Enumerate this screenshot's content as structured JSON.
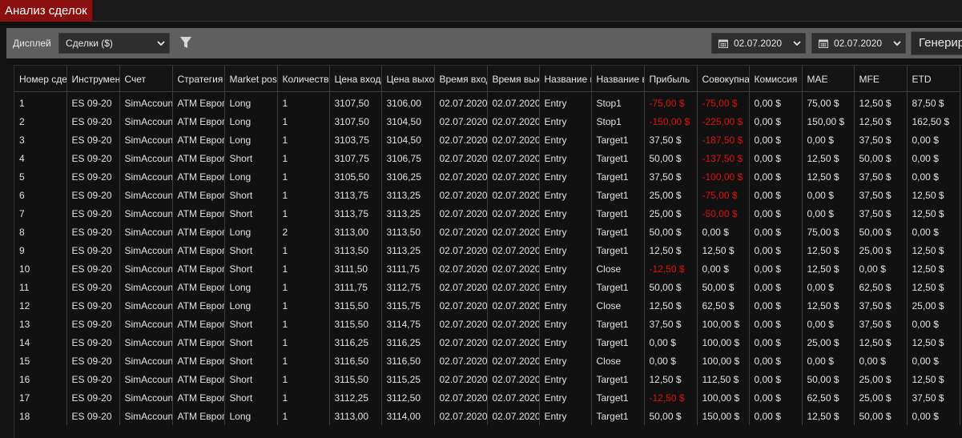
{
  "window": {
    "title": "Анализ сделок"
  },
  "toolbar": {
    "display_label": "Дисплей",
    "display_value": "Сделки ($)",
    "date_from": "02.07.2020",
    "date_to": "02.07.2020",
    "generate_label": "Генерировать"
  },
  "colors": {
    "negative": "#e01010",
    "title_accent": "#8b1111"
  },
  "table": {
    "columns": [
      "Номер сделки",
      "Инструмент",
      "Счет",
      "Стратегия",
      "Market position",
      "Количество",
      "Цена входа",
      "Цена выхода",
      "Время входа",
      "Время выхода",
      "Название входа",
      "Название выхода",
      "Прибыль",
      "Совокупная прибыль",
      "Комиссия",
      "MAE",
      "MFE",
      "ETD"
    ],
    "rows": [
      [
        "1",
        "ES 09-20",
        "SimAccount",
        "ATM Европа",
        "Long",
        "1",
        "3107,50",
        "3106,00",
        "02.07.2020",
        "02.07.2020",
        "Entry",
        "Stop1",
        "-75,00 $",
        "-75,00 $",
        "0,00 $",
        "75,00 $",
        "12,50 $",
        "87,50 $"
      ],
      [
        "2",
        "ES 09-20",
        "SimAccount",
        "ATM Европа",
        "Long",
        "1",
        "3107,50",
        "3104,50",
        "02.07.2020",
        "02.07.2020",
        "Entry",
        "Stop1",
        "-150,00 $",
        "-225,00 $",
        "0,00 $",
        "150,00 $",
        "12,50 $",
        "162,50 $"
      ],
      [
        "3",
        "ES 09-20",
        "SimAccount",
        "ATM Европа",
        "Long",
        "1",
        "3103,75",
        "3104,50",
        "02.07.2020",
        "02.07.2020",
        "Entry",
        "Target1",
        "37,50 $",
        "-187,50 $",
        "0,00 $",
        "0,00 $",
        "37,50 $",
        "0,00 $"
      ],
      [
        "4",
        "ES 09-20",
        "SimAccount",
        "ATM Европа",
        "Short",
        "1",
        "3107,75",
        "3106,75",
        "02.07.2020",
        "02.07.2020",
        "Entry",
        "Target1",
        "50,00 $",
        "-137,50 $",
        "0,00 $",
        "12,50 $",
        "50,00 $",
        "0,00 $"
      ],
      [
        "5",
        "ES 09-20",
        "SimAccount",
        "ATM Европа",
        "Long",
        "1",
        "3105,50",
        "3106,25",
        "02.07.2020",
        "02.07.2020",
        "Entry",
        "Target1",
        "37,50 $",
        "-100,00 $",
        "0,00 $",
        "12,50 $",
        "37,50 $",
        "0,00 $"
      ],
      [
        "6",
        "ES 09-20",
        "SimAccount",
        "ATM Европа",
        "Short",
        "1",
        "3113,75",
        "3113,25",
        "02.07.2020",
        "02.07.2020",
        "Entry",
        "Target1",
        "25,00 $",
        "-75,00 $",
        "0,00 $",
        "0,00 $",
        "37,50 $",
        "12,50 $"
      ],
      [
        "7",
        "ES 09-20",
        "SimAccount",
        "ATM Европа",
        "Short",
        "1",
        "3113,75",
        "3113,25",
        "02.07.2020",
        "02.07.2020",
        "Entry",
        "Target1",
        "25,00 $",
        "-50,00 $",
        "0,00 $",
        "0,00 $",
        "37,50 $",
        "12,50 $"
      ],
      [
        "8",
        "ES 09-20",
        "SimAccount",
        "ATM Европа",
        "Long",
        "2",
        "3113,00",
        "3113,50",
        "02.07.2020",
        "02.07.2020",
        "Entry",
        "Target1",
        "50,00 $",
        "0,00 $",
        "0,00 $",
        "75,00 $",
        "50,00 $",
        "0,00 $"
      ],
      [
        "9",
        "ES 09-20",
        "SimAccount",
        "ATM Европа",
        "Short",
        "1",
        "3113,50",
        "3113,25",
        "02.07.2020",
        "02.07.2020",
        "Entry",
        "Target1",
        "12,50 $",
        "12,50 $",
        "0,00 $",
        "12,50 $",
        "25,00 $",
        "12,50 $"
      ],
      [
        "10",
        "ES 09-20",
        "SimAccount",
        "ATM Европа",
        "Short",
        "1",
        "3111,50",
        "3111,75",
        "02.07.2020",
        "02.07.2020",
        "Entry",
        "Close",
        "-12,50 $",
        "0,00 $",
        "0,00 $",
        "12,50 $",
        "0,00 $",
        "12,50 $"
      ],
      [
        "11",
        "ES 09-20",
        "SimAccount",
        "ATM Европа",
        "Long",
        "1",
        "3111,75",
        "3112,75",
        "02.07.2020",
        "02.07.2020",
        "Entry",
        "Target1",
        "50,00 $",
        "50,00 $",
        "0,00 $",
        "0,00 $",
        "62,50 $",
        "12,50 $"
      ],
      [
        "12",
        "ES 09-20",
        "SimAccount",
        "ATM Европа",
        "Long",
        "1",
        "3115,50",
        "3115,75",
        "02.07.2020",
        "02.07.2020",
        "Entry",
        "Close",
        "12,50 $",
        "62,50 $",
        "0,00 $",
        "12,50 $",
        "37,50 $",
        "25,00 $"
      ],
      [
        "13",
        "ES 09-20",
        "SimAccount",
        "ATM Европа",
        "Short",
        "1",
        "3115,50",
        "3114,75",
        "02.07.2020",
        "02.07.2020",
        "Entry",
        "Target1",
        "37,50 $",
        "100,00 $",
        "0,00 $",
        "0,00 $",
        "37,50 $",
        "0,00 $"
      ],
      [
        "14",
        "ES 09-20",
        "SimAccount",
        "ATM Европа",
        "Short",
        "1",
        "3116,25",
        "3116,25",
        "02.07.2020",
        "02.07.2020",
        "Entry",
        "Target1",
        "0,00 $",
        "100,00 $",
        "0,00 $",
        "25,00 $",
        "12,50 $",
        "12,50 $"
      ],
      [
        "15",
        "ES 09-20",
        "SimAccount",
        "ATM Европа",
        "Short",
        "1",
        "3116,50",
        "3116,50",
        "02.07.2020",
        "02.07.2020",
        "Entry",
        "Close",
        "0,00 $",
        "100,00 $",
        "0,00 $",
        "0,00 $",
        "0,00 $",
        "0,00 $"
      ],
      [
        "16",
        "ES 09-20",
        "SimAccount",
        "ATM Европа",
        "Short",
        "1",
        "3115,50",
        "3115,25",
        "02.07.2020",
        "02.07.2020",
        "Entry",
        "Target1",
        "12,50 $",
        "112,50 $",
        "0,00 $",
        "50,00 $",
        "25,00 $",
        "12,50 $"
      ],
      [
        "17",
        "ES 09-20",
        "SimAccount",
        "ATM Европа",
        "Short",
        "1",
        "3112,25",
        "3112,50",
        "02.07.2020",
        "02.07.2020",
        "Entry",
        "Target1",
        "-12,50 $",
        "100,00 $",
        "0,00 $",
        "62,50 $",
        "25,00 $",
        "37,50 $"
      ],
      [
        "18",
        "ES 09-20",
        "SimAccount",
        "ATM Европа",
        "Long",
        "1",
        "3113,00",
        "3114,00",
        "02.07.2020",
        "02.07.2020",
        "Entry",
        "Target1",
        "50,00 $",
        "150,00 $",
        "0,00 $",
        "12,50 $",
        "50,00 $",
        "0,00 $"
      ]
    ]
  }
}
